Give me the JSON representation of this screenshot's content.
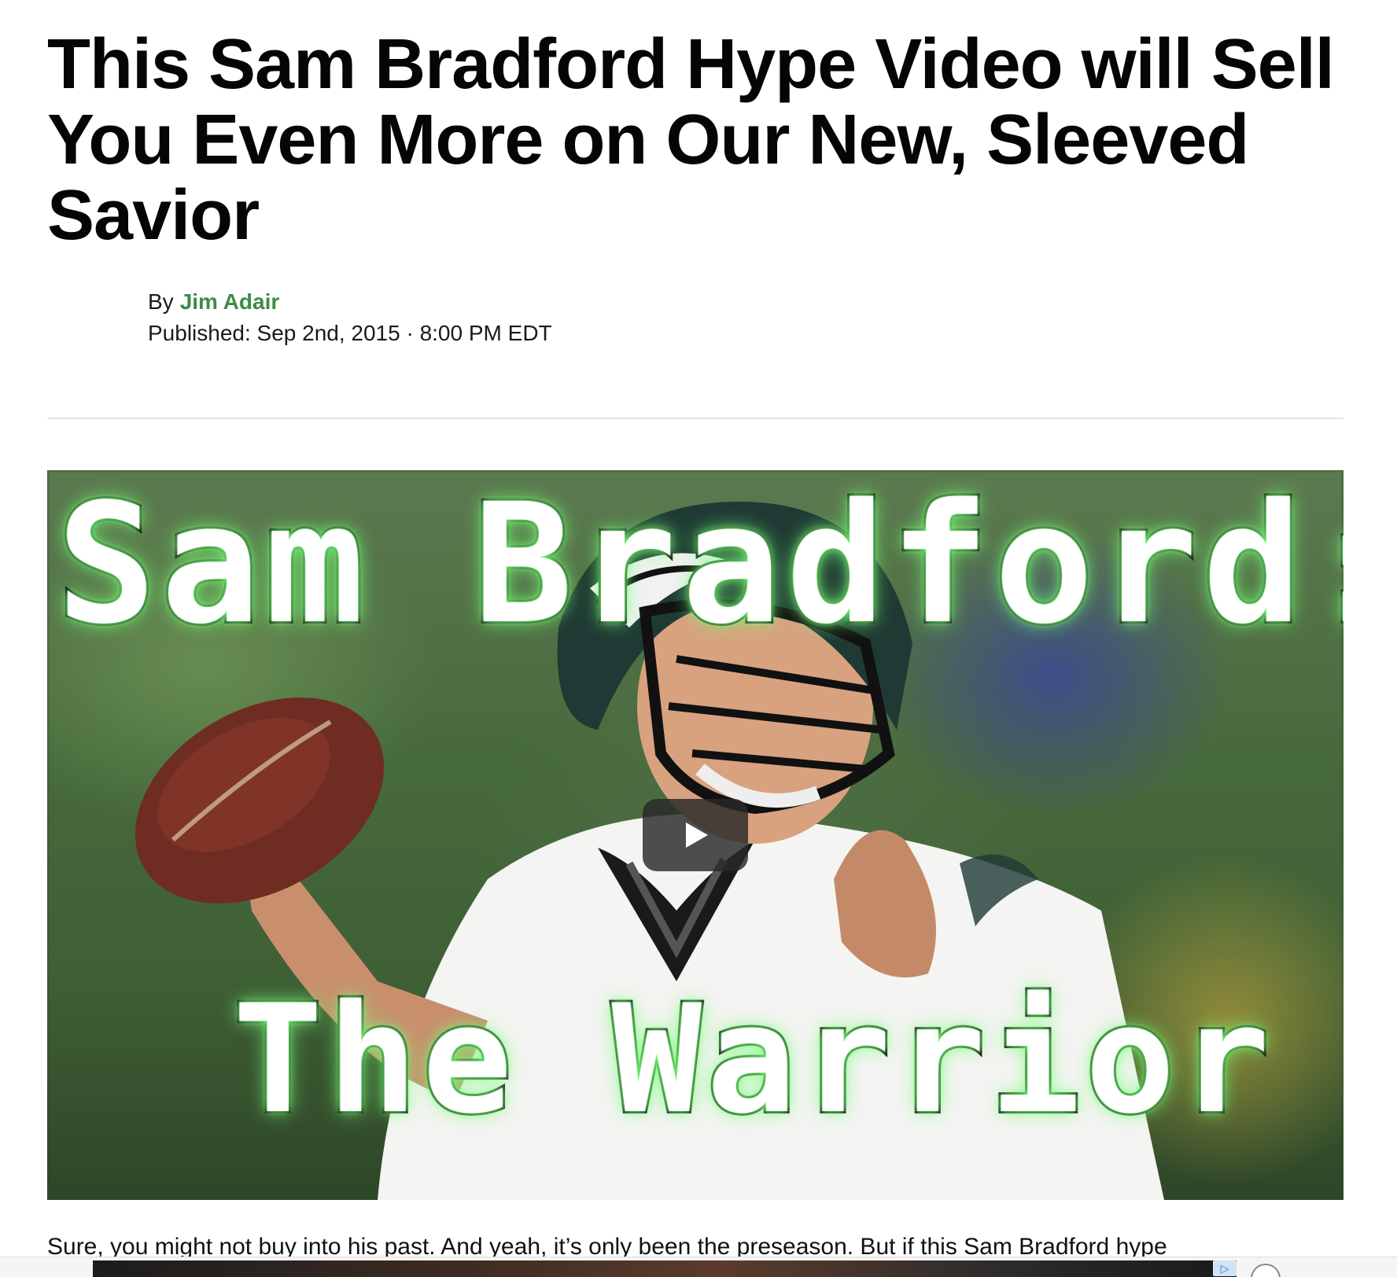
{
  "article": {
    "headline": "This Sam Bradford Hype Video will Sell You Even More on Our New, Sleeved Savior",
    "byline_prefix": "By",
    "author": "Jim Adair",
    "published": "Published: Sep 2nd, 2015 · 8:00 PM EDT",
    "body_first_line": "Sure, you might not buy into his past. And yeah, it’s only been the preseason. But if this Sam Bradford hype"
  },
  "video": {
    "title_top": "Sam Bradford:",
    "title_bottom": "The Warrior",
    "play_icon": "play-icon"
  },
  "ad": {
    "badge_icon": "adchoices-icon",
    "close_icon": "close-icon"
  },
  "colors": {
    "author_link": "#3d8b46",
    "headline": "#050505",
    "divider": "#e6e6e6"
  }
}
